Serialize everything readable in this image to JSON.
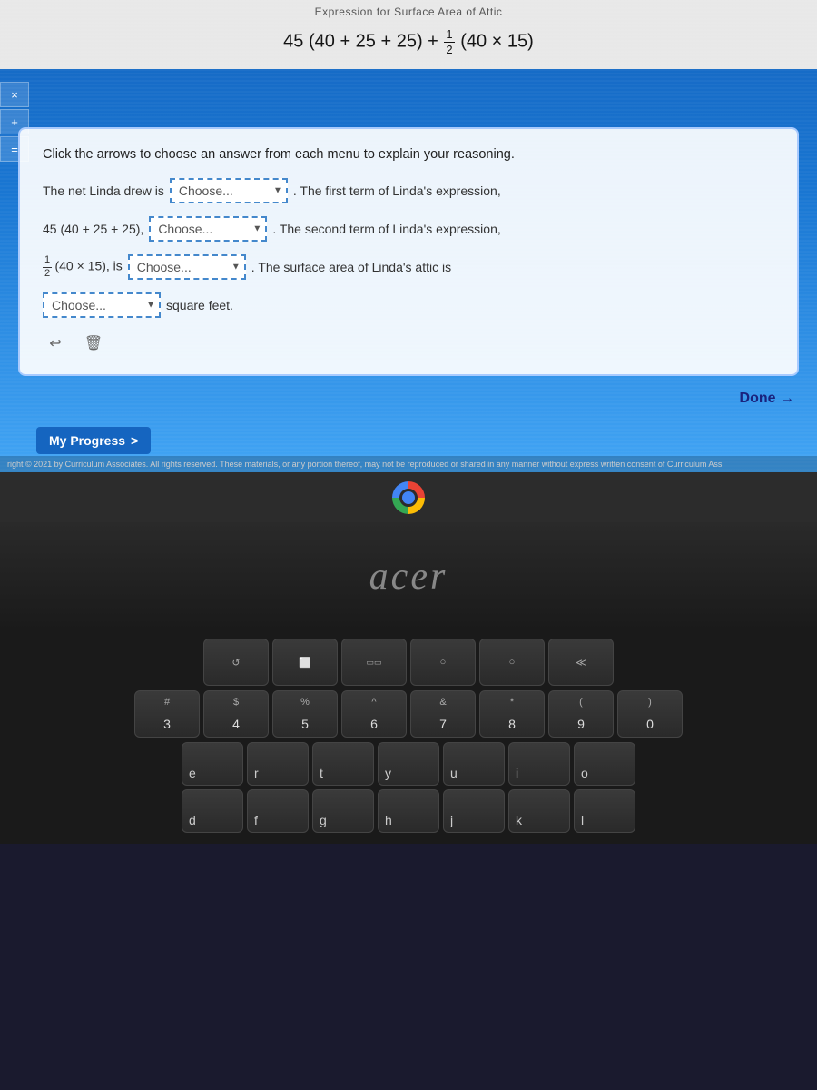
{
  "page": {
    "title": "Expression for Surface Area of Attic"
  },
  "formula": {
    "label": "Expression for Surface Area of Attic",
    "display": "45 (40 + 25 + 25) + ½(40 × 15)"
  },
  "toolbar": {
    "close_btn": "×",
    "add_btn": "+",
    "equals_btn": "="
  },
  "card": {
    "instruction": "Click the arrows to choose an answer from each menu to explain your reasoning.",
    "row1": {
      "prefix": "The net Linda drew is",
      "dropdown1_placeholder": "Choose...",
      "suffix": ". The first term of Linda's expression,"
    },
    "row2": {
      "prefix": "45 (40 + 25 + 25),",
      "dropdown2_placeholder": "Choose...",
      "suffix": ". The second term of Linda's expression,"
    },
    "row3": {
      "prefix": "½(40 × 15), is",
      "dropdown3_placeholder": "Choose...",
      "suffix": ". The surface area of Linda's attic is"
    },
    "row4": {
      "dropdown4_placeholder": "Choose...",
      "suffix": "square feet."
    }
  },
  "done_btn": "Done →",
  "progress_btn": {
    "label": "My Progress",
    "arrow": ">"
  },
  "copyright": "right © 2021 by Curriculum Associates. All rights reserved. These materials, or any portion thereof, may not be reproduced or shared in any manner without express written consent of Curriculum Ass",
  "acer": {
    "logo": "acer"
  },
  "keyboard": {
    "row1": [
      {
        "top": "",
        "bottom": "",
        "icon": "↺"
      },
      {
        "top": "",
        "bottom": "",
        "icon": "⬜"
      },
      {
        "top": "",
        "bottom": "",
        "icon": "▭▭"
      },
      {
        "top": "",
        "bottom": "",
        "icon": "○"
      },
      {
        "top": "",
        "bottom": "",
        "icon": "○"
      },
      {
        "top": "",
        "bottom": "",
        "icon": "≪"
      }
    ],
    "row2": [
      {
        "top": "#",
        "bottom": "3"
      },
      {
        "top": "$",
        "bottom": "4"
      },
      {
        "top": "%",
        "bottom": "5"
      },
      {
        "top": "^",
        "bottom": "6"
      },
      {
        "top": "&",
        "bottom": "7"
      },
      {
        "top": "*",
        "bottom": "8"
      },
      {
        "top": "(",
        "bottom": "9"
      },
      {
        "top": ")",
        "bottom": "0"
      }
    ],
    "row3_letters": [
      "e",
      "r",
      "t",
      "y",
      "u",
      "i",
      "o"
    ],
    "row4_letters": [
      "d",
      "f",
      "g",
      "h",
      "j",
      "k",
      "l"
    ]
  }
}
